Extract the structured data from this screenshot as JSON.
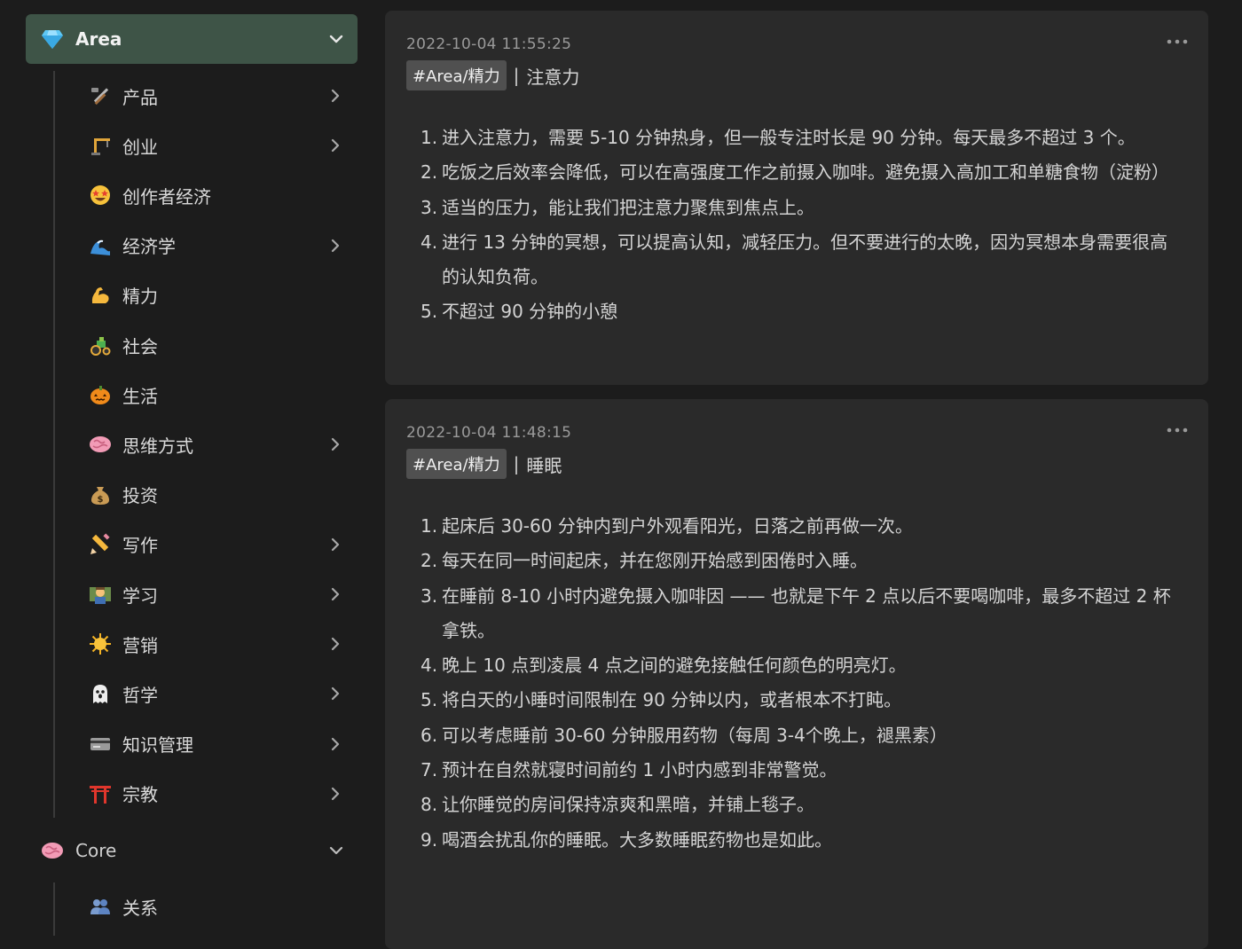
{
  "sidebar": {
    "area": {
      "label": "Area",
      "icon": "gem-icon"
    },
    "area_items": [
      {
        "label": "产品",
        "icon": "hammer-wrench-icon",
        "chevron": true
      },
      {
        "label": "创业",
        "icon": "crane-icon",
        "chevron": true
      },
      {
        "label": "创作者经济",
        "icon": "star-struck-face-icon",
        "chevron": false
      },
      {
        "label": "经济学",
        "icon": "wave-icon",
        "chevron": true
      },
      {
        "label": "精力",
        "icon": "flexed-biceps-icon",
        "chevron": false
      },
      {
        "label": "社会",
        "icon": "tractor-icon",
        "chevron": false
      },
      {
        "label": "生活",
        "icon": "pumpkin-icon",
        "chevron": false
      },
      {
        "label": "思维方式",
        "icon": "brain-icon",
        "chevron": true
      },
      {
        "label": "投资",
        "icon": "money-bag-icon",
        "chevron": false
      },
      {
        "label": "写作",
        "icon": "pencil-icon",
        "chevron": true
      },
      {
        "label": "学习",
        "icon": "teacher-icon",
        "chevron": true
      },
      {
        "label": "营销",
        "icon": "sun-icon",
        "chevron": true
      },
      {
        "label": "哲学",
        "icon": "ghost-icon",
        "chevron": true
      },
      {
        "label": "知识管理",
        "icon": "card-icon",
        "chevron": true
      },
      {
        "label": "宗教",
        "icon": "torii-gate-icon",
        "chevron": true
      }
    ],
    "core": {
      "label": "Core",
      "icon": "brain-icon"
    },
    "core_items": [
      {
        "label": "关系",
        "icon": "people-icon",
        "chevron": false
      }
    ]
  },
  "notes": [
    {
      "timestamp": "2022-10-04 11:55:25",
      "tag": "#Area/精力",
      "separator": "|",
      "title": "注意力",
      "items": [
        "进入注意力，需要 5-10 分钟热身，但一般专注时长是 90 分钟。每天最多不超过 3 个。",
        "吃饭之后效率会降低，可以在高强度工作之前摄入咖啡。避免摄入高加工和单糖食物（淀粉）",
        "适当的压力，能让我们把注意力聚焦到焦点上。",
        "进行 13 分钟的冥想，可以提高认知，减轻压力。但不要进行的太晚，因为冥想本身需要很高的认知负荷。",
        "不超过 90 分钟的小憩"
      ]
    },
    {
      "timestamp": "2022-10-04 11:48:15",
      "tag": "#Area/精力",
      "separator": "|",
      "title": "睡眠",
      "items": [
        "起床后 30-60 分钟内到户外观看阳光，日落之前再做一次。",
        "每天在同一时间起床，并在您刚开始感到困倦时入睡。",
        "在睡前 8-10 小时内避免摄入咖啡因 —— 也就是下午 2 点以后不要喝咖啡，最多不超过 2 杯拿铁。",
        "晚上 10 点到凌晨 4 点之间的避免接触任何颜色的明亮灯。",
        "将白天的小睡时间限制在 90 分钟以内，或者根本不打盹。",
        "可以考虑睡前 30-60 分钟服用药物（每周 3-4个晚上，褪黑素）",
        "预计在自然就寝时间前约 1 小时内感到非常警觉。",
        "让你睡觉的房间保持凉爽和黑暗，并铺上毯子。",
        "喝酒会扰乱你的睡眠。大多数睡眠药物也是如此。"
      ]
    }
  ]
}
